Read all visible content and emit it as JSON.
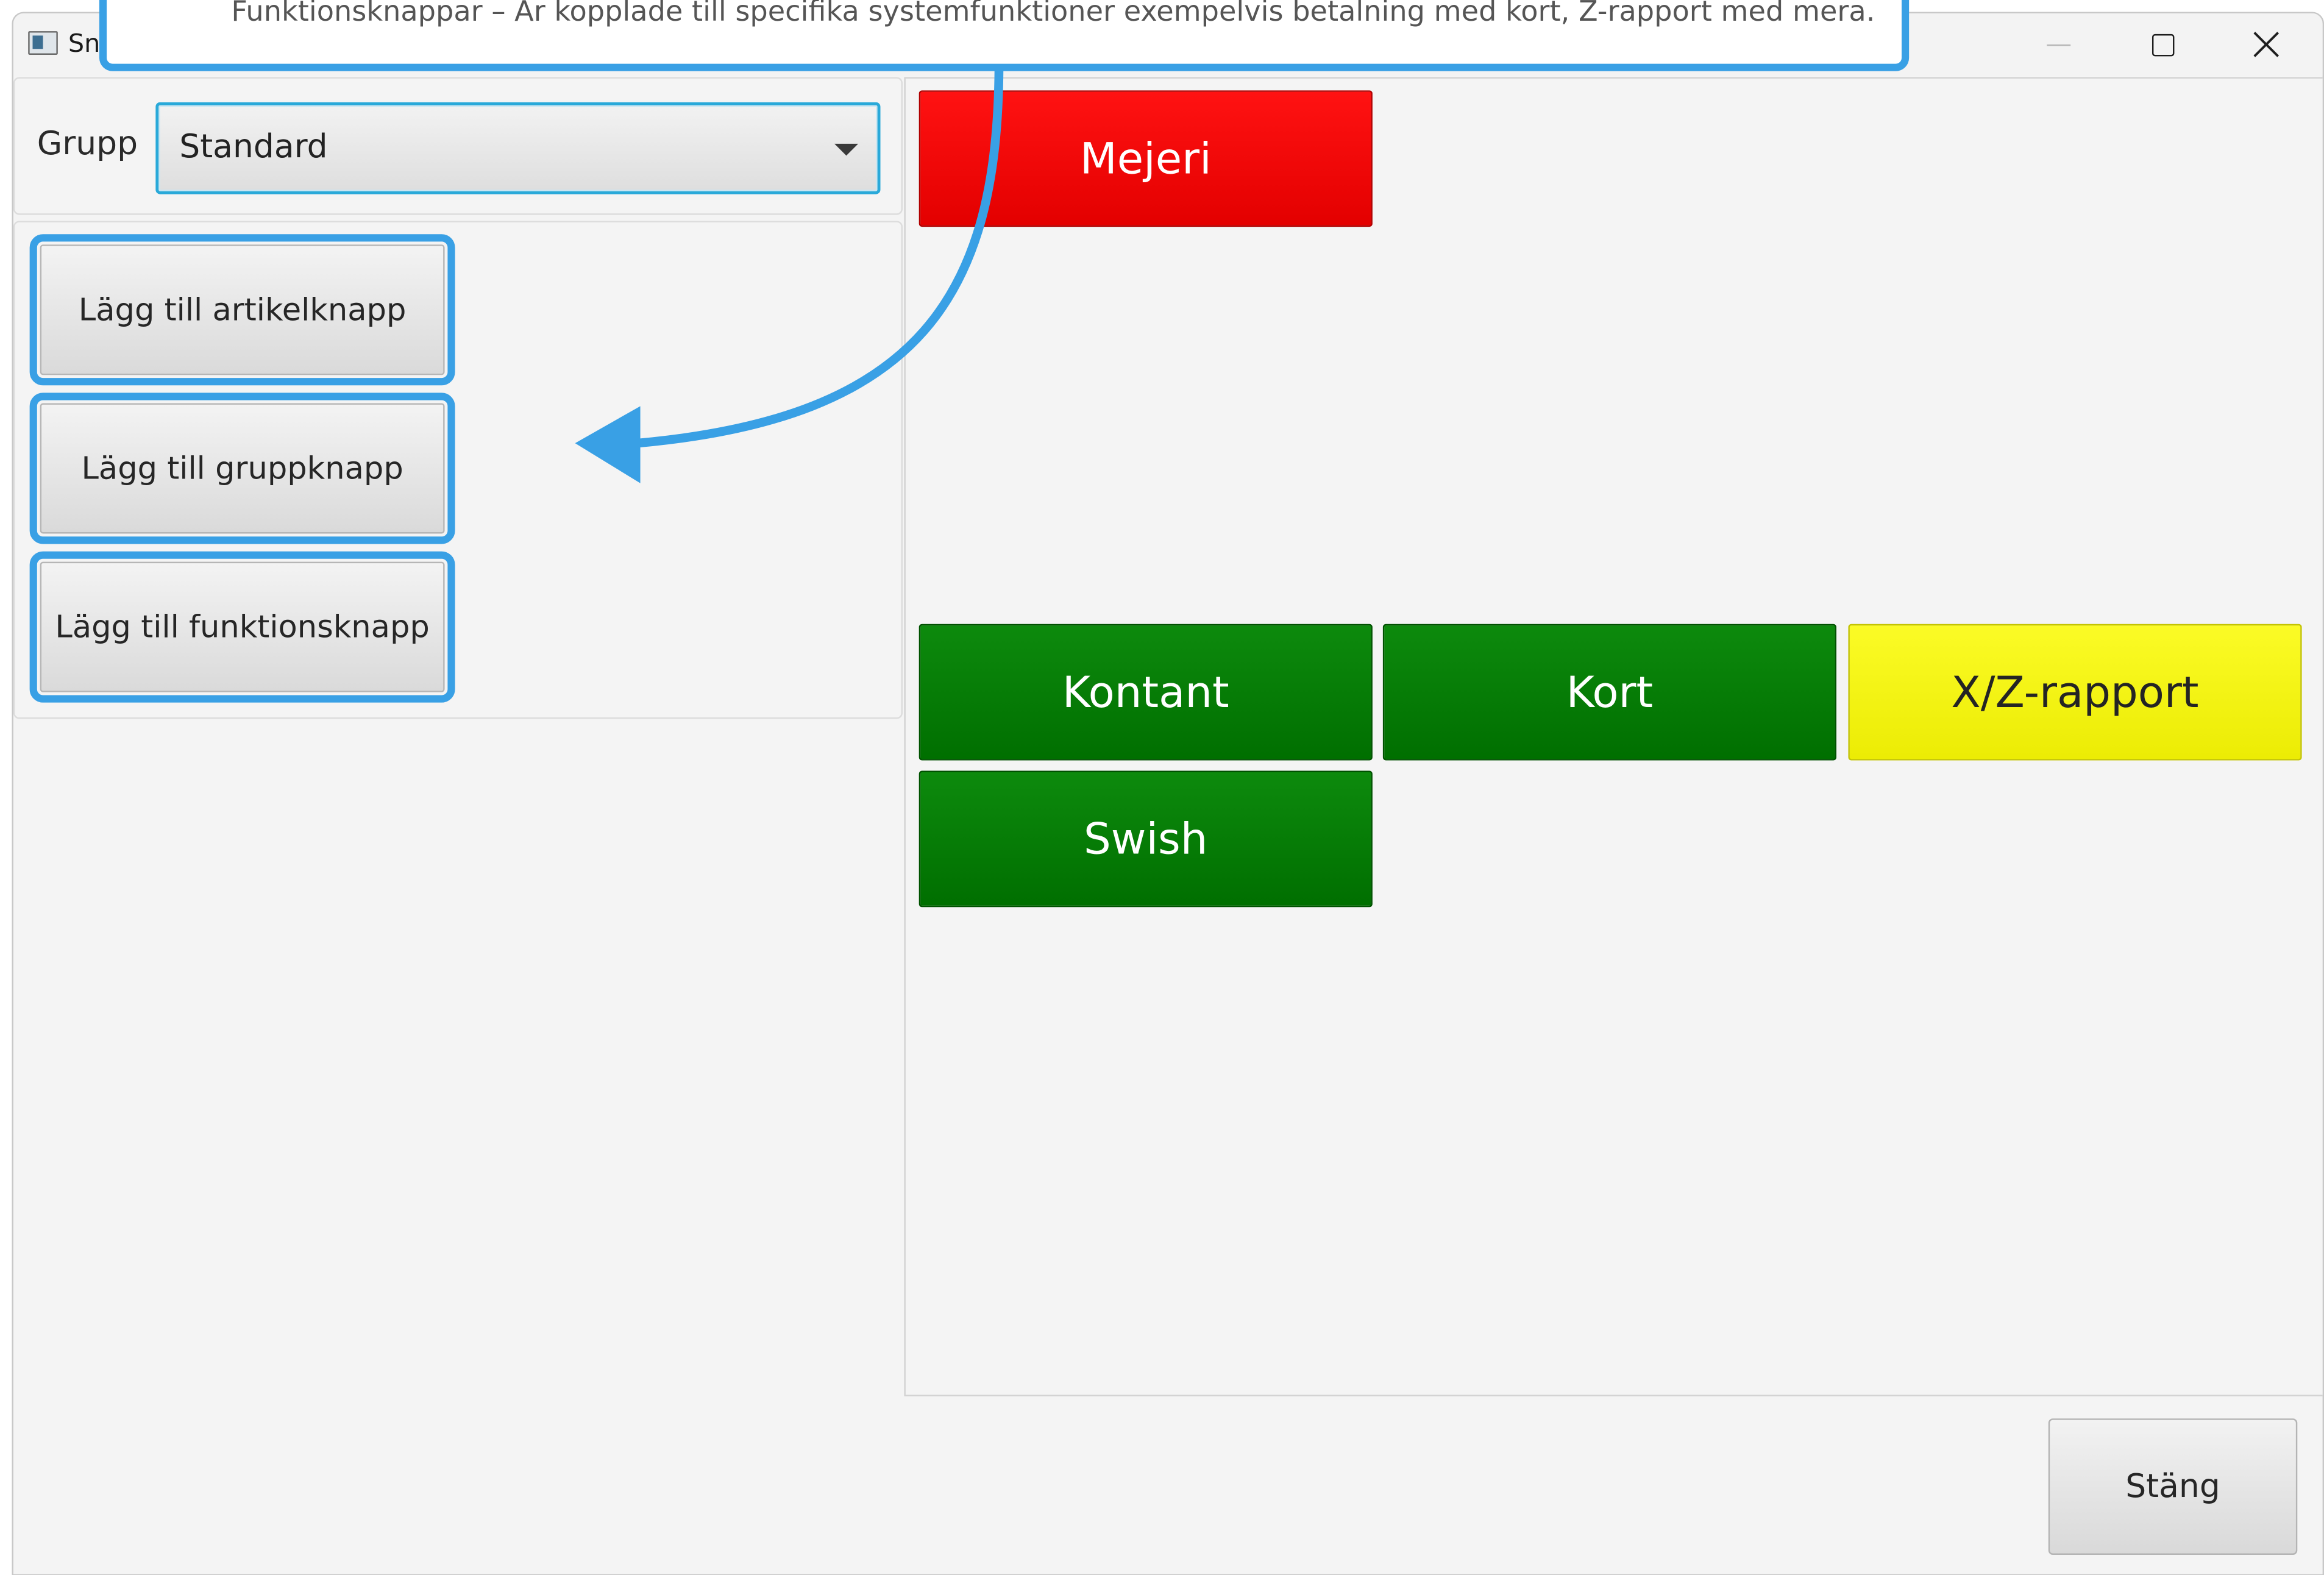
{
  "window": {
    "title": "Sn",
    "controls": {
      "minimize_icon": "minimize-icon",
      "maximize_icon": "maximize-icon",
      "close_icon": "close-icon"
    }
  },
  "group_selector": {
    "label": "Grupp",
    "selected": "Standard"
  },
  "add_buttons": {
    "article": "Lägg till artikelknapp",
    "group": "Lägg till gruppknapp",
    "function": "Lägg till funktionsknapp"
  },
  "tiles": {
    "mejeri": "Mejeri",
    "kontant": "Kontant",
    "kort": "Kort",
    "xz_report": "X/Z-rapport",
    "swish": "Swish"
  },
  "footer": {
    "close_label": "Stäng"
  },
  "callout": {
    "text": "Funktionsknappar – Är kopplade till specifika systemfunktioner exempelvis betalning med kort, Z-rapport med mera."
  },
  "colors": {
    "highlight": "#39a0e5",
    "tile_red": "#f00000",
    "tile_green": "#007d00",
    "tile_yellow": "#f3f30e",
    "combo_focus": "#29a9d9"
  }
}
